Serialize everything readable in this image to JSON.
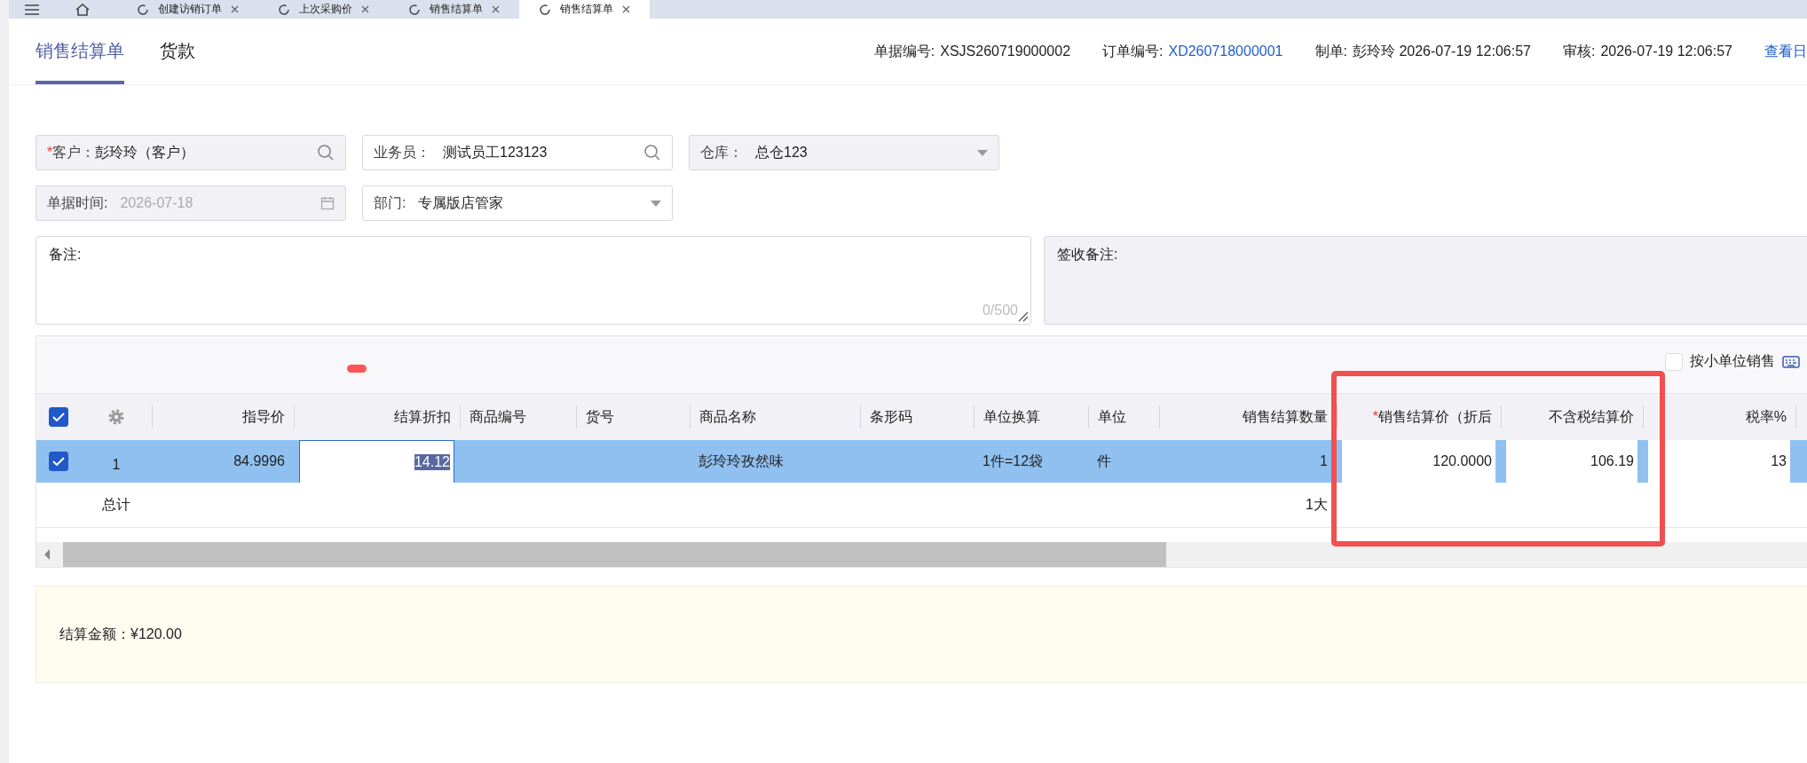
{
  "app_tabs": [
    {
      "label": "创建访销订单",
      "selected": false
    },
    {
      "label": "上次采购价",
      "selected": false
    },
    {
      "label": "销售结算单",
      "selected": false
    },
    {
      "label": "销售结算单",
      "selected": true
    }
  ],
  "page_tabs": [
    {
      "label": "销售结算单",
      "selected": true
    },
    {
      "label": "货款",
      "selected": false
    }
  ],
  "doc_info": [
    {
      "label": "单据编号:",
      "value": "XSJS260719000002",
      "kind": "text"
    },
    {
      "label": "订单编号:",
      "value": "XD260718000001",
      "kind": "link"
    },
    {
      "label": "制单:",
      "value": "彭玲玲 2026-07-19 12:06:57",
      "kind": "text"
    },
    {
      "label": "审核:",
      "value": "2026-07-19 12:06:57",
      "kind": "text"
    }
  ],
  "log_link": "查看日",
  "fields": [
    [
      {
        "required_mark": "*",
        "label": "客户：",
        "value": "彭玲玲（客户）",
        "disabled": true,
        "kind": "search"
      },
      {
        "label": "业务员：",
        "value": "测试员工123123",
        "disabled": false,
        "kind": "search"
      },
      {
        "label": "仓库：",
        "value": "总仓123",
        "disabled": true,
        "kind": "select"
      }
    ],
    [
      {
        "label": "单据时间:",
        "value": "2026-07-18",
        "disabled": true,
        "kind": "date"
      },
      {
        "label": "部门:",
        "value": "专属版店管家",
        "disabled": false,
        "kind": "select"
      }
    ]
  ],
  "remarks": {
    "label": "备注:",
    "counter": "0/500",
    "disabled": false
  },
  "receipt_remarks": {
    "label": "签收备注:",
    "disabled": true
  },
  "small_unit": {
    "label": "按小单位销售",
    "checked": false
  },
  "table": {
    "all_selected": true,
    "columns": [
      {
        "label": "指导价",
        "kind": "number"
      },
      {
        "label": "结算折扣",
        "kind": "input"
      },
      {
        "label": "商品编号",
        "kind": "text"
      },
      {
        "label": "货号",
        "kind": "text"
      },
      {
        "label": "商品名称",
        "kind": "text"
      },
      {
        "label": "条形码",
        "kind": "text"
      },
      {
        "label": "单位换算",
        "kind": "text"
      },
      {
        "label": "单位",
        "kind": "text"
      },
      {
        "label": "销售结算数量",
        "kind": "number"
      },
      {
        "required_mark": "*",
        "label": "销售结算价（折后",
        "kind": "input"
      },
      {
        "label": "不含税结算价",
        "kind": "input"
      },
      {
        "label": "税率%",
        "kind": "input"
      }
    ],
    "rows": [
      {
        "selected": true,
        "index": "1",
        "cells": [
          {
            "text": "84.9996"
          },
          {
            "text": "14.12",
            "focused": true
          },
          null,
          null,
          {
            "text": "彭玲玲孜然味"
          },
          null,
          {
            "text": "1件=12袋"
          },
          {
            "text": "件"
          },
          {
            "text": "1"
          },
          {
            "text": "120.0000",
            "focused": false
          },
          {
            "text": "106.19",
            "focused": false
          },
          {
            "text": "13",
            "focused": false
          }
        ]
      }
    ],
    "total": {
      "label": "总计",
      "quantity": "1大"
    }
  },
  "summary": {
    "label": "结算金额：",
    "value": "¥120.00"
  }
}
